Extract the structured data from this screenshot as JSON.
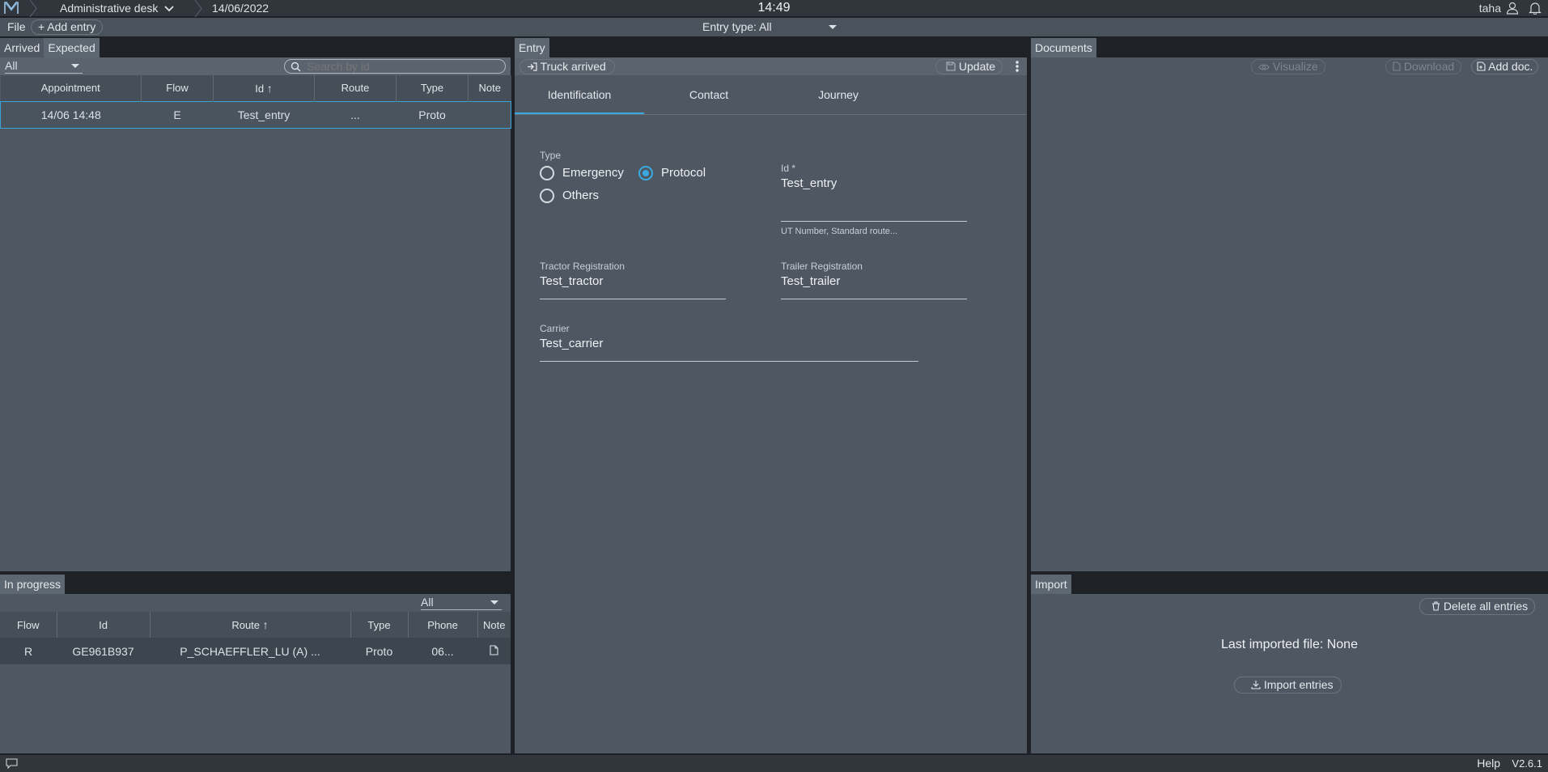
{
  "topbar": {
    "desk": "Administrative desk",
    "date": "14/06/2022",
    "clock": "14:49",
    "user": "taha"
  },
  "menubar": {
    "file": "File",
    "add_entry": "Add entry",
    "entry_type": "Entry type: All"
  },
  "left": {
    "tabs": [
      "Arrived",
      "Expected"
    ],
    "filter": "All",
    "search_placeholder": "Search by id",
    "columns": [
      "Appointment",
      "Flow",
      "Id",
      "Route",
      "Type",
      "Note"
    ],
    "rows": [
      {
        "appointment": "14/06 14:48",
        "flow": "E",
        "id": "Test_entry",
        "route": "...",
        "type": "Proto",
        "note": ""
      }
    ]
  },
  "progress": {
    "title": "In progress",
    "filter": "All",
    "columns": [
      "Flow",
      "Id",
      "Route",
      "Type",
      "Phone",
      "Note"
    ],
    "rows": [
      {
        "flow": "R",
        "id": "GE961B937",
        "route": "P_SCHAEFFLER_LU (A) ...",
        "type": "Proto",
        "phone": "06..."
      }
    ]
  },
  "entry": {
    "title": "Entry",
    "truck_arrived": "Truck arrived",
    "update": "Update",
    "tabs": [
      "Identification",
      "Contact",
      "Journey"
    ],
    "type_label": "Type",
    "type_options": [
      "Emergency",
      "Protocol",
      "Others"
    ],
    "type_selected": "Protocol",
    "id_label": "Id *",
    "id_value": "Test_entry",
    "id_hint": "UT Number, Standard route...",
    "tractor_label": "Tractor Registration",
    "tractor_value": "Test_tractor",
    "trailer_label": "Trailer Registration",
    "trailer_value": "Test_trailer",
    "carrier_label": "Carrier",
    "carrier_value": "Test_carrier"
  },
  "documents": {
    "title": "Documents",
    "visualize": "Visualize",
    "download": "Download",
    "add_doc": "Add doc."
  },
  "import": {
    "title": "Import",
    "delete_all": "Delete all entries",
    "last_file": "Last imported file: None",
    "import_entries": "Import entries"
  },
  "statusbar": {
    "help": "Help",
    "version": "V2.6.1"
  },
  "colors": {
    "accent": "#3aa9e0",
    "panel": "#4f5862",
    "chrome": "#30363c"
  }
}
